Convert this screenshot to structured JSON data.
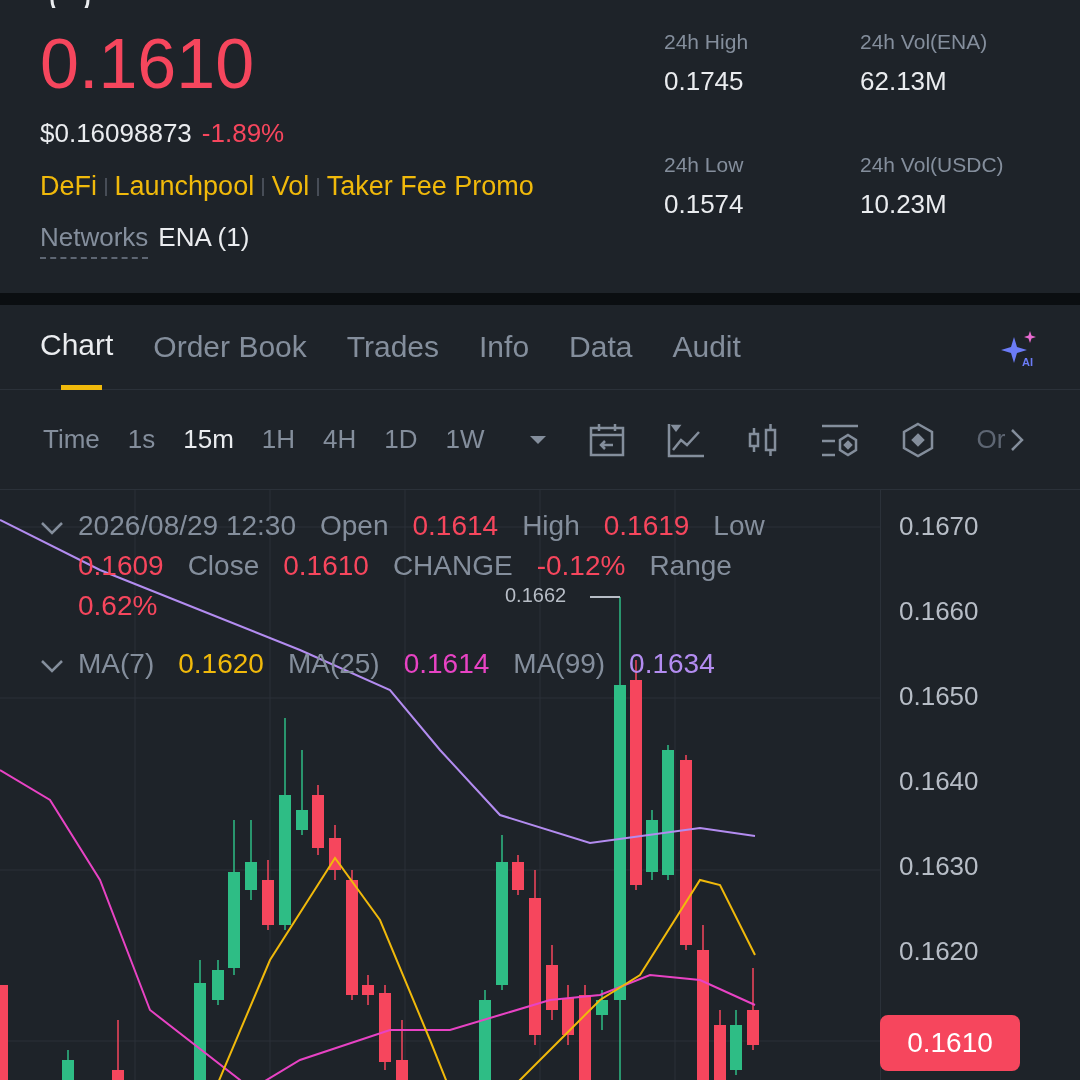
{
  "header": {
    "price": "0.1610",
    "usd_price": "$0.16098873",
    "change": "-1.89%",
    "tags": [
      "DeFi",
      "Launchpool",
      "Vol",
      "Taker Fee Promo"
    ],
    "networks_label": "Networks",
    "network_value": "ENA (1)"
  },
  "stats": [
    {
      "label": "24h High",
      "value": "0.1745"
    },
    {
      "label": "24h Vol(ENA)",
      "value": "62.13M"
    },
    {
      "label": "24h Low",
      "value": "0.1574"
    },
    {
      "label": "24h Vol(USDC)",
      "value": "10.23M"
    }
  ],
  "tabs": [
    {
      "label": "Chart",
      "selected": true
    },
    {
      "label": "Order Book",
      "selected": false
    },
    {
      "label": "Trades",
      "selected": false
    },
    {
      "label": "Info",
      "selected": false
    },
    {
      "label": "Data",
      "selected": false
    },
    {
      "label": "Audit",
      "selected": false
    }
  ],
  "intervals": [
    {
      "label": "Time",
      "selected": false
    },
    {
      "label": "1s",
      "selected": false
    },
    {
      "label": "15m",
      "selected": true
    },
    {
      "label": "1H",
      "selected": false
    },
    {
      "label": "4H",
      "selected": false
    },
    {
      "label": "1D",
      "selected": false
    },
    {
      "label": "1W",
      "selected": false
    }
  ],
  "ai_badge": "AI",
  "toolbar_more": "Or",
  "candle_info": [
    {
      "kind": "label",
      "text": "2026/08/29 12:30"
    },
    {
      "kind": "label",
      "text": "Open"
    },
    {
      "kind": "value",
      "text": "0.1614"
    },
    {
      "kind": "label",
      "text": "High"
    },
    {
      "kind": "value",
      "text": "0.1619"
    },
    {
      "kind": "label",
      "text": "Low"
    },
    {
      "kind": "value",
      "text": "0.1609"
    },
    {
      "kind": "label",
      "text": "Close"
    },
    {
      "kind": "value",
      "text": "0.1610"
    },
    {
      "kind": "label",
      "text": "CHANGE"
    },
    {
      "kind": "value",
      "text": "-0.12%"
    },
    {
      "kind": "label",
      "text": "Range"
    },
    {
      "kind": "value",
      "text": "0.62%"
    }
  ],
  "moving_averages": [
    {
      "label": "MA(7)",
      "value": "0.1620",
      "color": "#f0b90b"
    },
    {
      "label": "MA(25)",
      "value": "0.1614",
      "color": "#e843c4"
    },
    {
      "label": "MA(99)",
      "value": "0.1634",
      "color": "#b38cf0"
    }
  ],
  "price_axis": [
    "0.1670",
    "0.1660",
    "0.1650",
    "0.1640",
    "0.1630",
    "0.1620"
  ],
  "high_marker": "0.1662",
  "last_price_tag": "0.1610"
}
